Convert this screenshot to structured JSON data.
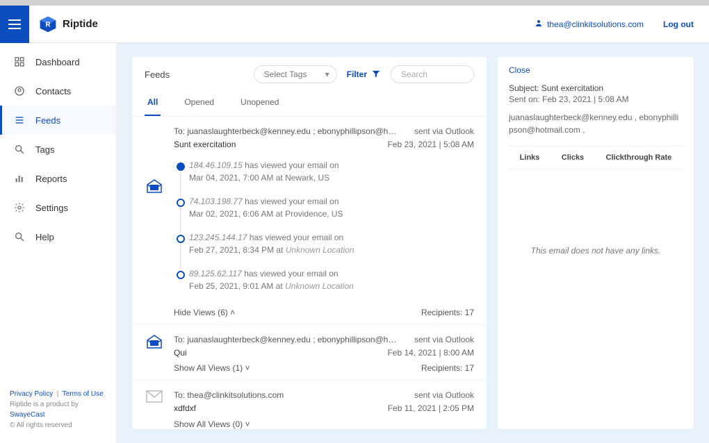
{
  "brand": "Riptide",
  "header": {
    "user_email": "thea@clinkitsolutions.com",
    "logout": "Log out"
  },
  "sidebar": {
    "items": [
      {
        "label": "Dashboard",
        "icon": "dashboard-icon"
      },
      {
        "label": "Contacts",
        "icon": "contacts-icon"
      },
      {
        "label": "Feeds",
        "icon": "feeds-icon",
        "active": true
      },
      {
        "label": "Tags",
        "icon": "magnify-icon"
      },
      {
        "label": "Reports",
        "icon": "bars-icon"
      },
      {
        "label": "Settings",
        "icon": "gear-icon"
      },
      {
        "label": "Help",
        "icon": "help-icon"
      }
    ],
    "footer": {
      "priv": "Privacy Policy",
      "terms": "Terms of Use",
      "line2a": "Riptide is a product by ",
      "line2b": "SwayeCast",
      "line3": "© All rights reserved"
    }
  },
  "feeds_panel": {
    "title": "Feeds",
    "select_tags": "Select Tags",
    "filter": "Filter",
    "search_placeholder": "Search",
    "tabs": {
      "all": "All",
      "opened": "Opened",
      "unopened": "Unopened"
    }
  },
  "feed_items": {
    "item1": {
      "to": "To: juanaslaughterbeck@kenney.edu ; ebonyphillipson@h…",
      "sent_via": "sent via Outlook",
      "subject": "Sunt exercitation",
      "date": "Feb 23, 2021  |  5:08 AM",
      "views": [
        {
          "ip": "184.46.109.15",
          "rest": "has viewed your email on",
          "when": "Mar 04, 2021, 7:00 AM at Newark, US",
          "loc_italic": false
        },
        {
          "ip": "74.103.198.77",
          "rest": "has viewed your email on",
          "when": "Mar 02, 2021, 6:06 AM at Providence, US",
          "loc_italic": false
        },
        {
          "ip": "123.245.144.17",
          "rest": "has viewed your email on",
          "when_prefix": "Feb 27, 2021, 8:34 PM at ",
          "loc": "Unknown Location",
          "loc_italic": true
        },
        {
          "ip": "89.125.62.117",
          "rest": "has viewed your email on",
          "when_prefix": "Feb 25, 2021, 9:01 AM at ",
          "loc": "Unknown Location",
          "loc_italic": true
        }
      ],
      "hide_views": "Hide Views (6)  ˄",
      "recipients_label": "Recipients: 17"
    },
    "item2": {
      "to": "To: juanaslaughterbeck@kenney.edu ; ebonyphillipson@h…",
      "sent_via": "sent via Outlook",
      "subject": "Qui",
      "date": "Feb 14, 2021  |  8:00 AM",
      "show": "Show All Views (1)  ˅",
      "recipients_label": "Recipients: 17"
    },
    "item3": {
      "to": "To: thea@clinkitsolutions.com",
      "sent_via": "sent via Outlook",
      "subject": "xdfdxf",
      "date": "Feb 11, 2021  |  2:05 PM",
      "show": "Show All Views (0)  ˅"
    }
  },
  "detail": {
    "close": "Close",
    "subject_label": "Subject:",
    "subject_value": "Sunt exercitation",
    "sent_label": "Sent on:",
    "sent_value": "Feb 23, 2021  |  5:08 AM",
    "recipients": "juanaslaughterbeck@kenney.edu , ebonyphillipson@hotmail.com ,",
    "stats": {
      "links": "Links",
      "clicks": "Clicks",
      "ctr": "Clickthrough Rate"
    },
    "no_links": "This email does not have any links."
  }
}
